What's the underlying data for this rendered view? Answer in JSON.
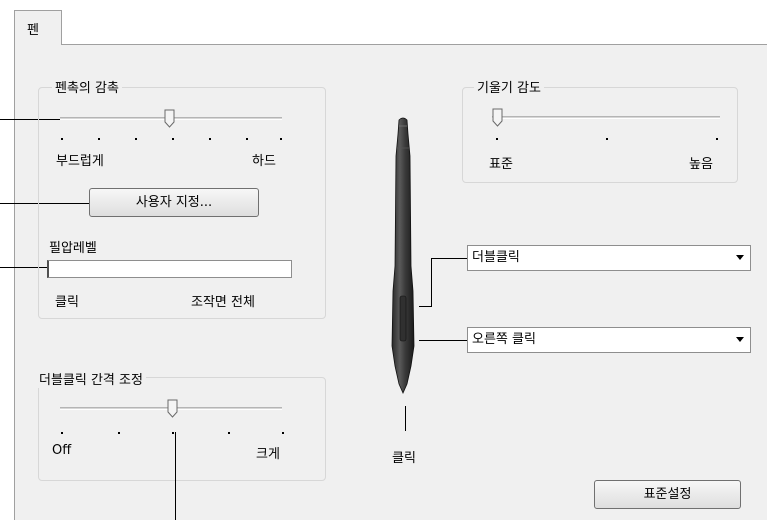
{
  "tab": {
    "label": "펜"
  },
  "tip_feel": {
    "title": "펜촉의 감촉",
    "left_label": "부드럽게",
    "right_label": "하드",
    "custom_button": "사용자 지정...",
    "slider_position": 0.5
  },
  "pressure": {
    "title": "필압레벨",
    "left_label": "클릭",
    "right_label": "조작면 전체"
  },
  "double_click": {
    "title": "더블클릭 간격 조정",
    "left_label": "Off",
    "right_label": "크게",
    "slider_position": 0.5
  },
  "tilt": {
    "title": "기울기 감도",
    "left_label": "표준",
    "right_label": "높음",
    "slider_position": 0.0
  },
  "pen_buttons": {
    "upper": "더블클릭",
    "lower": "오른쪽 클릭",
    "tip_label": "클릭"
  },
  "default_button": "표준설정"
}
